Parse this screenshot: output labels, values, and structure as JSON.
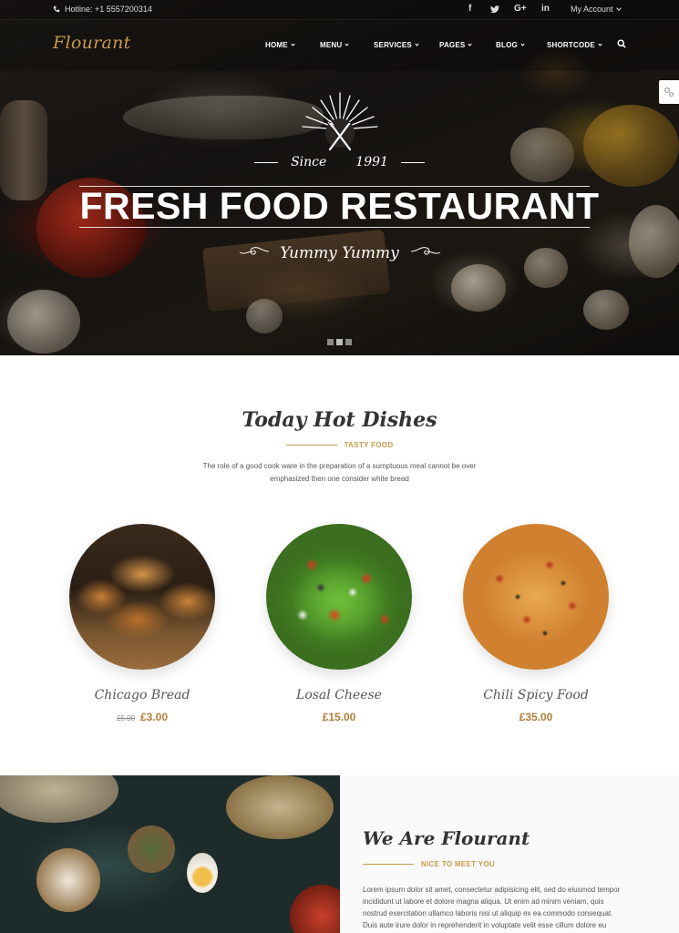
{
  "topbar": {
    "hotline": "Hotline: +1 5557200314",
    "social": [
      {
        "icon": "facebook-icon",
        "glyph": "f"
      },
      {
        "icon": "twitter-icon",
        "glyph": "t"
      },
      {
        "icon": "google-plus-icon",
        "glyph": "G+"
      },
      {
        "icon": "linkedin-icon",
        "glyph": "in"
      }
    ],
    "account": "My Account"
  },
  "nav": {
    "logo": "Flourant",
    "items": [
      "HOME",
      "MENU",
      "SERVICES",
      "PAGES",
      "BLOG",
      "SHORTCODE"
    ]
  },
  "hero": {
    "since": "Since",
    "year": "1991",
    "title": "FRESH FOOD RESTAURANT",
    "tagline": "Yummy Yummy",
    "slides": 3,
    "active_slide": 2
  },
  "hot_dishes": {
    "title": "Today Hot Dishes",
    "subtitle": "TASTY FOOD",
    "intro": "The role of a good cook ware in the preparation of a sumptuous meal cannot be over emphasized then one consider white bread",
    "items": [
      {
        "name": "Chicago Bread",
        "old_price": "£5.00",
        "price": "£3.00"
      },
      {
        "name": "Losal Cheese",
        "old_price": "",
        "price": "£15.00"
      },
      {
        "name": "Chili Spicy Food",
        "old_price": "",
        "price": "£35.00"
      }
    ]
  },
  "about": {
    "title": "We Are Flourant",
    "subtitle": "NICE TO MEET YOU",
    "text": "Lorem ipsum dolor sit amet, consectetur adipisicing elit, sed do eiusmod tempor incididunt ut labore et dolore magna aliqua. Ut enim ad minim veniam, quis nostrud exercitation ullamco laboris nisi ut aliquip ex ea commodo consequat. Duis aute irure dolor in reprehenderit in voluptate velit esse cillum dolore eu"
  },
  "colors": {
    "accent": "#c79a4b",
    "price": "#b0803a"
  }
}
